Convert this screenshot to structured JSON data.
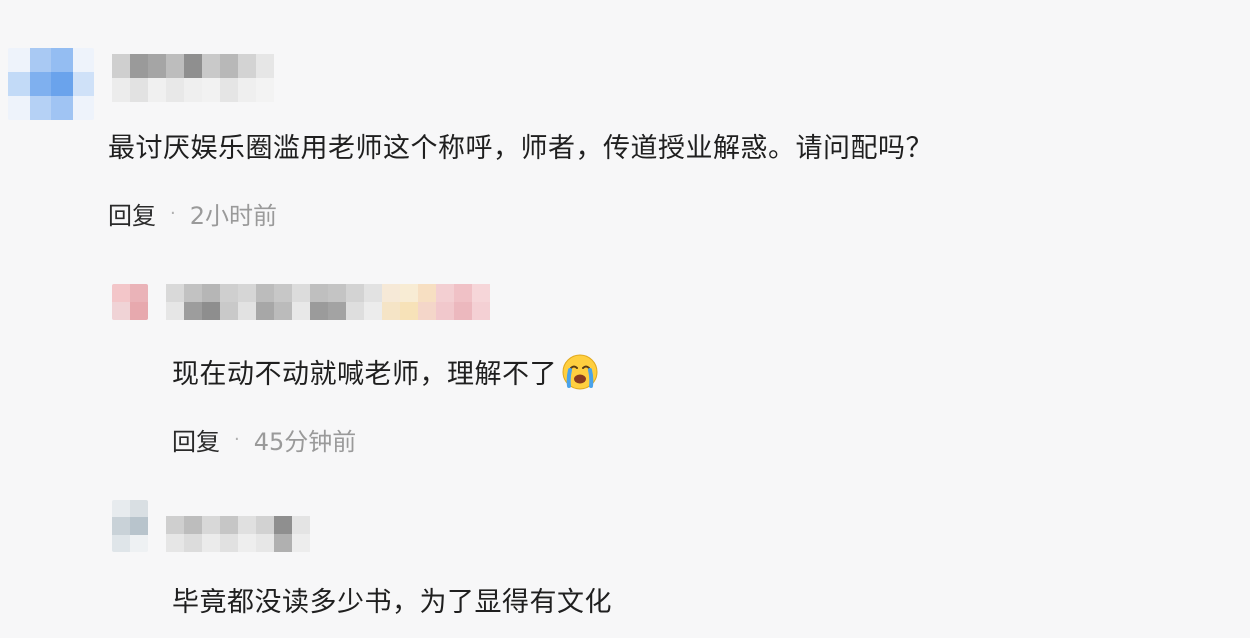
{
  "comments": [
    {
      "text": "最讨厌娱乐圈滥用老师这个称呼，师者，传道授业解惑。请问配吗？",
      "reply_label": "回复",
      "separator": "·",
      "time": "2小时前"
    },
    {
      "text": "现在动不动就喊老师，理解不了",
      "emoji": "crying-face-icon",
      "reply_label": "回复",
      "separator": "·",
      "time": "45分钟前"
    },
    {
      "text": "毕竟都没读多少书，为了显得有文化"
    }
  ],
  "colors": {
    "text": "#1f1f1f",
    "meta": "#9a9a9a",
    "background": "#f7f7f8"
  }
}
